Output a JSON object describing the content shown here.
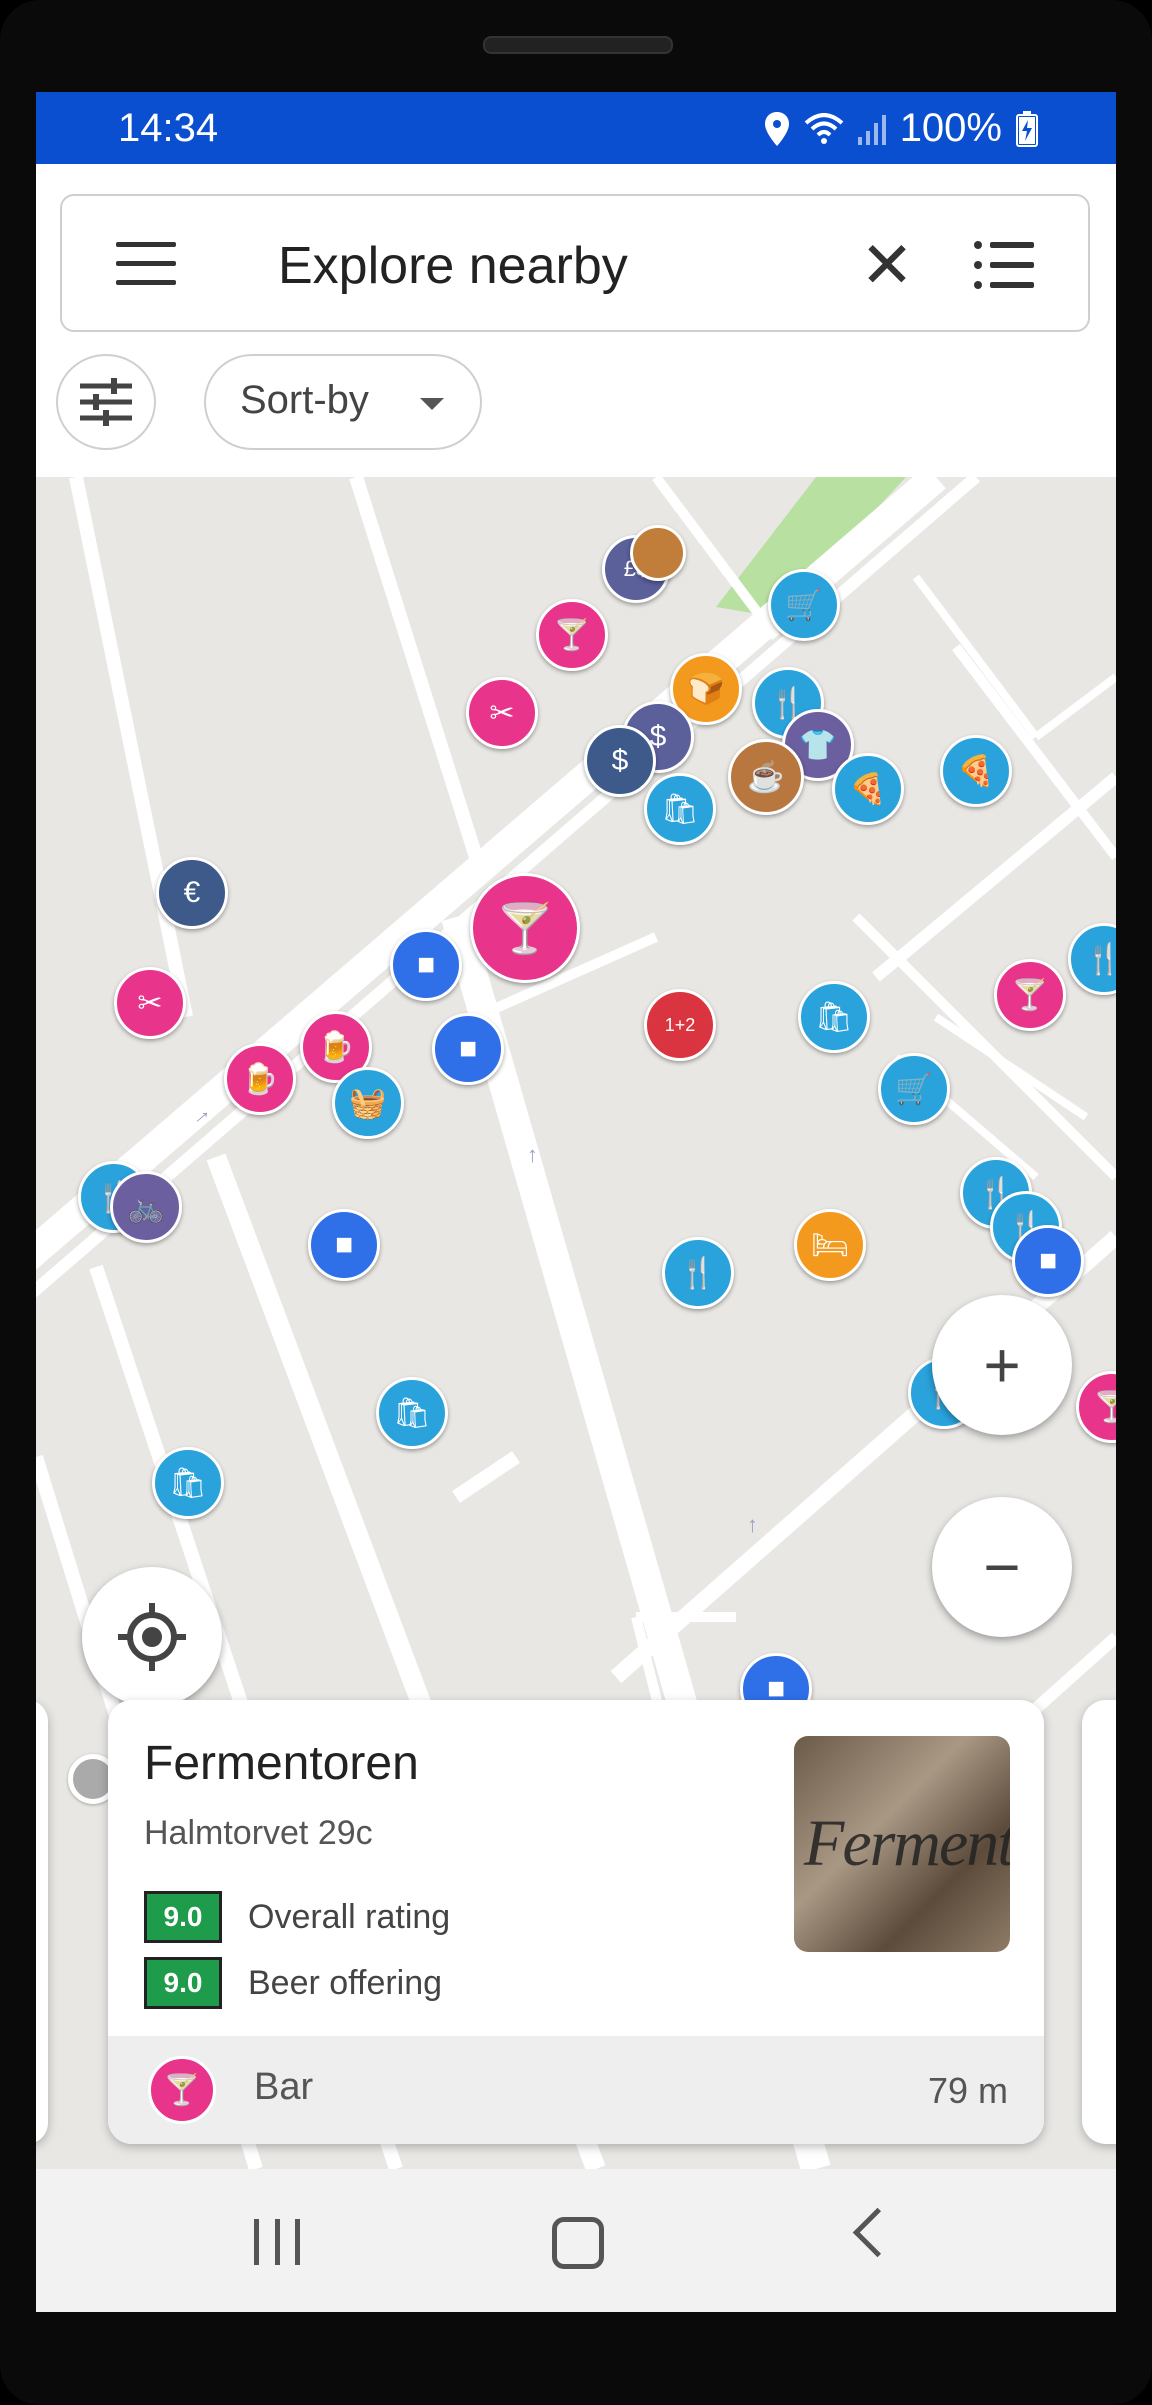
{
  "status_bar": {
    "time": "14:34",
    "battery": "100%",
    "icons": [
      "location-icon",
      "wifi-icon",
      "signal-icon",
      "battery-charging-icon"
    ]
  },
  "search": {
    "text": "Explore nearby",
    "menu_icon": "hamburger-icon",
    "clear_icon": "close-icon",
    "list_icon": "list-view-icon"
  },
  "filters": {
    "filter_icon": "filter-sliders-icon",
    "sort_label": "Sort-by"
  },
  "map": {
    "zoom_in": "+",
    "zoom_out": "−",
    "locate_icon": "my-location-icon",
    "pois": [
      {
        "name": "currency-exchange-poi",
        "color": "#5b5f9a",
        "glyph": "£$"
      },
      {
        "name": "coffee-poi-top",
        "color": "#c17d3a",
        "glyph": ""
      },
      {
        "name": "bar-poi-top",
        "color": "#e8348a",
        "glyph": "🍸"
      },
      {
        "name": "shopping-cart-poi-top",
        "color": "#2aa2dc",
        "glyph": "🛒"
      },
      {
        "name": "hairdresser-poi-top",
        "color": "#e8348a",
        "glyph": "✂"
      },
      {
        "name": "bakery-poi",
        "color": "#f39a1e",
        "glyph": "🍞"
      },
      {
        "name": "restaurant-poi-top",
        "color": "#2aa2dc",
        "glyph": "🍴"
      },
      {
        "name": "bank-poi",
        "color": "#5b5f9a",
        "glyph": "$"
      },
      {
        "name": "atm-poi",
        "color": "#3d5a8a",
        "glyph": "$"
      },
      {
        "name": "clothes-poi",
        "color": "#6b5fa0",
        "glyph": "👕"
      },
      {
        "name": "cafe-poi",
        "color": "#b8773e",
        "glyph": "☕"
      },
      {
        "name": "shop-poi-top",
        "color": "#2aa2dc",
        "glyph": "🛍"
      },
      {
        "name": "pizza-poi-1",
        "color": "#2aa2dc",
        "glyph": "🍕"
      },
      {
        "name": "pizza-poi-2",
        "color": "#2aa2dc",
        "glyph": "🍕"
      },
      {
        "name": "exchange-poi-left",
        "color": "#3d5a8a",
        "glyph": "€"
      },
      {
        "name": "bar-poi-selected",
        "color": "#e8348a",
        "glyph": "🍸"
      },
      {
        "name": "parking-poi-1",
        "color": "#2f6fe8",
        "glyph": "■"
      },
      {
        "name": "restaurant-poi-right-edge",
        "color": "#2aa2dc",
        "glyph": "🍴"
      },
      {
        "name": "hairdresser-poi-left",
        "color": "#e8348a",
        "glyph": "✂"
      },
      {
        "name": "beer-poi-1",
        "color": "#e8348a",
        "glyph": "🍺"
      },
      {
        "name": "beer-poi-2",
        "color": "#e8348a",
        "glyph": "🍺"
      },
      {
        "name": "parking-poi-2",
        "color": "#2f6fe8",
        "glyph": "■"
      },
      {
        "name": "school-poi",
        "color": "#d9343f",
        "glyph": "1+2"
      },
      {
        "name": "shop-poi-mid",
        "color": "#2aa2dc",
        "glyph": "🛍"
      },
      {
        "name": "bar-poi-right",
        "color": "#e8348a",
        "glyph": "🍸"
      },
      {
        "name": "grocery-basket-poi",
        "color": "#2aa2dc",
        "glyph": "🧺"
      },
      {
        "name": "shopping-cart-poi-mid",
        "color": "#2aa2dc",
        "glyph": "🛒"
      },
      {
        "name": "restaurant-poi-left",
        "color": "#2aa2dc",
        "glyph": "🍴"
      },
      {
        "name": "bicycle-poi",
        "color": "#6b5fa0",
        "glyph": "🚲"
      },
      {
        "name": "parking-poi-3",
        "color": "#2f6fe8",
        "glyph": "■"
      },
      {
        "name": "restaurant-poi-mid",
        "color": "#2aa2dc",
        "glyph": "🍴"
      },
      {
        "name": "hotel-poi",
        "color": "#f39a1e",
        "glyph": "🛏"
      },
      {
        "name": "restaurant-poi-right-1",
        "color": "#2aa2dc",
        "glyph": "🍴"
      },
      {
        "name": "restaurant-poi-right-2",
        "color": "#2aa2dc",
        "glyph": "🍴"
      },
      {
        "name": "shop-poi-bottom",
        "color": "#2aa2dc",
        "glyph": "🛍"
      },
      {
        "name": "shop-poi-left-bottom",
        "color": "#2aa2dc",
        "glyph": "🛍"
      },
      {
        "name": "parking-poi-4",
        "color": "#2f6fe8",
        "glyph": "■"
      },
      {
        "name": "recycling-poi",
        "color": "#7ab928",
        "glyph": "♻"
      },
      {
        "name": "cafe-poi-bottom",
        "color": "#b8773e",
        "glyph": "☕"
      },
      {
        "name": "restaurant-poi-right-3",
        "color": "#2aa2dc",
        "glyph": "🍴"
      },
      {
        "name": "bar-poi-right-edge",
        "color": "#e8348a",
        "glyph": "🍸"
      },
      {
        "name": "parking-poi-5",
        "color": "#2f6fe8",
        "glyph": "■"
      }
    ]
  },
  "card": {
    "title": "Fermentoren",
    "address": "Halmtorvet 29c",
    "ratings": [
      {
        "value": "9.0",
        "label": "Overall rating",
        "color": "#1e9b4b"
      },
      {
        "value": "9.0",
        "label": "Beer offering",
        "color": "#1e9b4b"
      }
    ],
    "category": "Bar",
    "category_icon": "cocktail-icon",
    "category_color": "#e8348a",
    "distance": "79 m",
    "photo_text": "Fermentoren"
  },
  "nav": {
    "recents_icon": "recents-icon",
    "home_icon": "home-icon",
    "back_icon": "back-icon"
  }
}
